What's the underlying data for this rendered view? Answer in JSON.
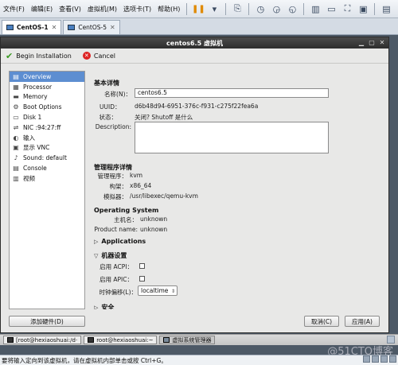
{
  "vmware": {
    "menus": [
      "文件(F)",
      "编辑(E)",
      "查看(V)",
      "虚拟机(M)",
      "选项卡(T)",
      "帮助(H)"
    ],
    "tabs": [
      {
        "label": "CentOS-1"
      },
      {
        "label": "CentOS-5"
      }
    ],
    "status_text": "要将输入定向到该虚拟机，请在虚拟机内部单击或按 Ctrl+G。"
  },
  "window": {
    "title": "centos6.5 虚拟机",
    "toolbar": {
      "begin_label": "Begin Installation",
      "cancel_label": "Cancel"
    }
  },
  "sidebar": {
    "items": [
      {
        "label": "Overview",
        "icon": "info-icon",
        "glyph": "▤"
      },
      {
        "label": "Processor",
        "icon": "cpu-icon",
        "glyph": "▦"
      },
      {
        "label": "Memory",
        "icon": "memory-icon",
        "glyph": "▬"
      },
      {
        "label": "Boot Options",
        "icon": "gear-icon",
        "glyph": "⚙"
      },
      {
        "label": "Disk 1",
        "icon": "disk-icon",
        "glyph": "▭"
      },
      {
        "label": "NIC :94:27:ff",
        "icon": "network-icon",
        "glyph": "⇌"
      },
      {
        "label": "输入",
        "icon": "mouse-icon",
        "glyph": "◐"
      },
      {
        "label": "显示 VNC",
        "icon": "monitor-icon",
        "glyph": "▣"
      },
      {
        "label": "Sound: default",
        "icon": "speaker-icon",
        "glyph": "♪"
      },
      {
        "label": "Console",
        "icon": "console-icon",
        "glyph": "▤"
      },
      {
        "label": "视频",
        "icon": "video-icon",
        "glyph": "▥"
      }
    ],
    "add_hardware_label": "添加硬件(D)"
  },
  "overview": {
    "basic_title": "基本详情",
    "name_label": "名称(N)：",
    "name_value": "centos6.5",
    "uuid_label": "UUID：",
    "uuid_value": "d6b48d94-6951-376c-f931-c275f22fea6a",
    "state_label": "状态：",
    "state_value": "关闭? Shutoff 是什么",
    "description_label": "Description:",
    "hypervisor_title": "管理程序详情",
    "hypervisor_label": "管理程序：",
    "hypervisor_value": "kvm",
    "arch_label": "构架：",
    "arch_value": "x86_64",
    "emulator_label": "模拟器：",
    "emulator_value": "/usr/libexec/qemu-kvm",
    "os_title": "Operating System",
    "hostname_label": "主机名：",
    "hostname_value": "unknown",
    "product_label": "Product name:",
    "product_value": "unknown",
    "applications_label": "Applications",
    "machine_title": "机器设置",
    "acpi_label": "启用 ACPI：",
    "apic_label": "启用 APIC：",
    "clock_label": "时钟偏移(L)：",
    "clock_value": "localtime",
    "security_label": "安全"
  },
  "buttons": {
    "cancel_label": "取消(C)",
    "apply_label": "应用(A)"
  },
  "taskbar": {
    "tasks": [
      {
        "label": "[root@hexiaoshuai:/d·"
      },
      {
        "label": "root@hexiaoshuai:~"
      },
      {
        "label": "虚拟系统管理器"
      }
    ]
  },
  "watermark": "@51CTO博客"
}
